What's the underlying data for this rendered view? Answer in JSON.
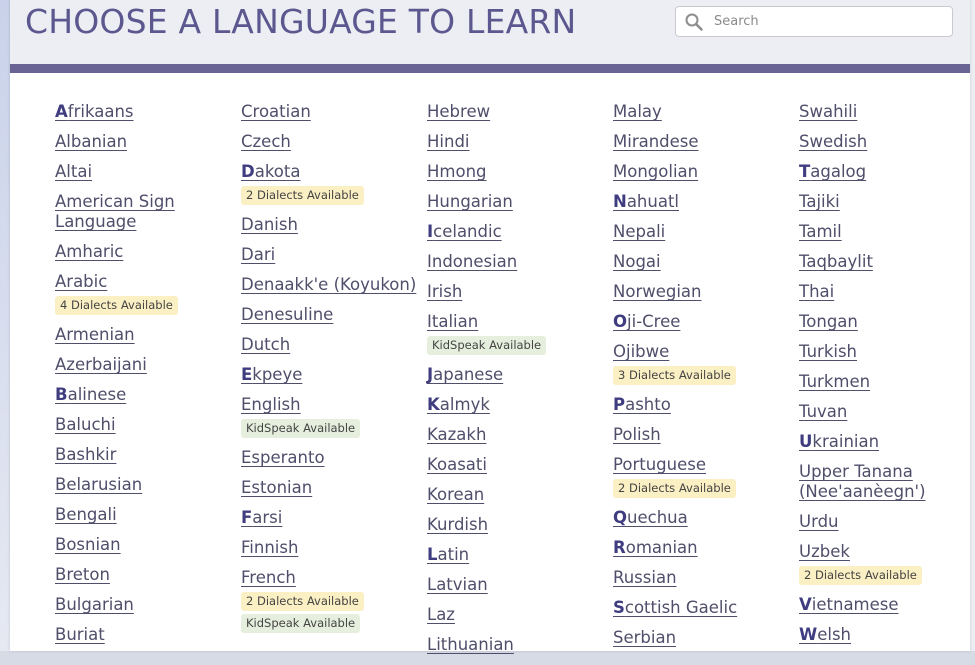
{
  "header": {
    "title": "CHOOSE A LANGUAGE TO LEARN",
    "search_placeholder": "Search"
  },
  "columns": [
    [
      {
        "first": "A",
        "rest": "frikaans"
      },
      {
        "first": "",
        "rest": "Albanian"
      },
      {
        "first": "",
        "rest": "Altai"
      },
      {
        "first": "",
        "rest": "American Sign Language"
      },
      {
        "first": "",
        "rest": "Amharic"
      },
      {
        "first": "",
        "rest": "Arabic",
        "badges": [
          {
            "type": "dialect",
            "text": "4 Dialects Available"
          }
        ]
      },
      {
        "first": "",
        "rest": "Armenian"
      },
      {
        "first": "",
        "rest": "Azerbaijani"
      },
      {
        "first": "B",
        "rest": "alinese"
      },
      {
        "first": "",
        "rest": "Baluchi"
      },
      {
        "first": "",
        "rest": "Bashkir"
      },
      {
        "first": "",
        "rest": "Belarusian"
      },
      {
        "first": "",
        "rest": "Bengali"
      },
      {
        "first": "",
        "rest": "Bosnian"
      },
      {
        "first": "",
        "rest": "Breton"
      },
      {
        "first": "",
        "rest": "Bulgarian"
      },
      {
        "first": "",
        "rest": "Buriat"
      }
    ],
    [
      {
        "first": "",
        "rest": "Croatian"
      },
      {
        "first": "",
        "rest": "Czech"
      },
      {
        "first": "D",
        "rest": "akota",
        "badges": [
          {
            "type": "dialect",
            "text": "2 Dialects Available"
          }
        ]
      },
      {
        "first": "",
        "rest": "Danish"
      },
      {
        "first": "",
        "rest": "Dari"
      },
      {
        "first": "",
        "rest": "Denaakk'e (Koyukon)"
      },
      {
        "first": "",
        "rest": "Denesuline"
      },
      {
        "first": "",
        "rest": "Dutch"
      },
      {
        "first": "E",
        "rest": "kpeye"
      },
      {
        "first": "",
        "rest": "English",
        "badges": [
          {
            "type": "kid",
            "text": "KidSpeak Available"
          }
        ]
      },
      {
        "first": "",
        "rest": "Esperanto"
      },
      {
        "first": "",
        "rest": "Estonian"
      },
      {
        "first": "F",
        "rest": "arsi"
      },
      {
        "first": "",
        "rest": "Finnish"
      },
      {
        "first": "",
        "rest": "French",
        "badges": [
          {
            "type": "dialect",
            "text": "2 Dialects Available"
          },
          {
            "type": "kid",
            "text": "KidSpeak Available"
          }
        ]
      }
    ],
    [
      {
        "first": "",
        "rest": "Hebrew"
      },
      {
        "first": "",
        "rest": "Hindi"
      },
      {
        "first": "",
        "rest": "Hmong"
      },
      {
        "first": "",
        "rest": "Hungarian"
      },
      {
        "first": "I",
        "rest": "celandic"
      },
      {
        "first": "",
        "rest": "Indonesian"
      },
      {
        "first": "",
        "rest": "Irish"
      },
      {
        "first": "",
        "rest": "Italian",
        "badges": [
          {
            "type": "kid",
            "text": "KidSpeak Available"
          }
        ]
      },
      {
        "first": "J",
        "rest": "apanese"
      },
      {
        "first": "K",
        "rest": "almyk"
      },
      {
        "first": "",
        "rest": "Kazakh"
      },
      {
        "first": "",
        "rest": "Koasati"
      },
      {
        "first": "",
        "rest": "Korean"
      },
      {
        "first": "",
        "rest": "Kurdish"
      },
      {
        "first": "L",
        "rest": "atin"
      },
      {
        "first": "",
        "rest": "Latvian"
      },
      {
        "first": "",
        "rest": "Laz"
      },
      {
        "first": "",
        "rest": "Lithuanian"
      }
    ],
    [
      {
        "first": "",
        "rest": "Malay"
      },
      {
        "first": "",
        "rest": "Mirandese"
      },
      {
        "first": "",
        "rest": "Mongolian"
      },
      {
        "first": "N",
        "rest": "ahuatl"
      },
      {
        "first": "",
        "rest": "Nepali"
      },
      {
        "first": "",
        "rest": "Nogai"
      },
      {
        "first": "",
        "rest": "Norwegian"
      },
      {
        "first": "O",
        "rest": "ji-Cree"
      },
      {
        "first": "",
        "rest": "Ojibwe",
        "badges": [
          {
            "type": "dialect",
            "text": "3 Dialects Available"
          }
        ]
      },
      {
        "first": "P",
        "rest": "ashto"
      },
      {
        "first": "",
        "rest": "Polish"
      },
      {
        "first": "",
        "rest": "Portuguese",
        "badges": [
          {
            "type": "dialect",
            "text": "2 Dialects Available"
          }
        ]
      },
      {
        "first": "Q",
        "rest": "uechua"
      },
      {
        "first": "R",
        "rest": "omanian"
      },
      {
        "first": "",
        "rest": "Russian"
      },
      {
        "first": "S",
        "rest": "cottish Gaelic"
      },
      {
        "first": "",
        "rest": "Serbian"
      }
    ],
    [
      {
        "first": "",
        "rest": "Swahili"
      },
      {
        "first": "",
        "rest": "Swedish"
      },
      {
        "first": "T",
        "rest": "agalog"
      },
      {
        "first": "",
        "rest": "Tajiki"
      },
      {
        "first": "",
        "rest": "Tamil"
      },
      {
        "first": "",
        "rest": "Taqbaylit"
      },
      {
        "first": "",
        "rest": "Thai"
      },
      {
        "first": "",
        "rest": "Tongan"
      },
      {
        "first": "",
        "rest": "Turkish"
      },
      {
        "first": "",
        "rest": "Turkmen"
      },
      {
        "first": "",
        "rest": "Tuvan"
      },
      {
        "first": "U",
        "rest": "krainian"
      },
      {
        "first": "",
        "rest": "Upper Tanana (Nee'aanèegn')"
      },
      {
        "first": "",
        "rest": "Urdu"
      },
      {
        "first": "",
        "rest": "Uzbek",
        "badges": [
          {
            "type": "dialect",
            "text": "2 Dialects Available"
          }
        ]
      },
      {
        "first": "V",
        "rest": "ietnamese"
      },
      {
        "first": "W",
        "rest": "elsh"
      }
    ]
  ]
}
